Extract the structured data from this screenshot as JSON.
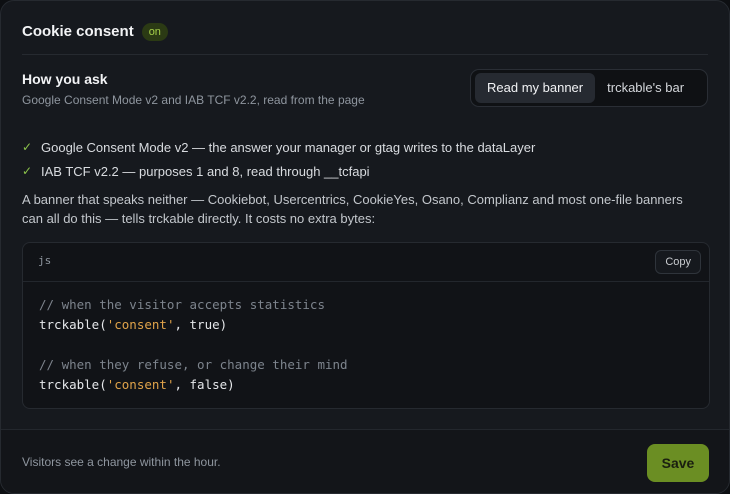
{
  "header": {
    "title": "Cookie consent",
    "badge": "on"
  },
  "section": {
    "title": "How you ask",
    "subtitle": "Google Consent Mode v2 and IAB TCF v2.2, read from the page"
  },
  "mode_toggle": {
    "options": [
      "Read my banner",
      "trckable's bar"
    ],
    "selected": "Read my banner"
  },
  "checks": [
    "Google Consent Mode v2 — the answer your manager or gtag writes to the dataLayer",
    "IAB TCF v2.2 — purposes 1 and 8, read through __tcfapi"
  ],
  "paragraph": "A banner that speaks neither — Cookiebot, Usercentrics, CookieYes, Osano, Complianz and most one-file banners can all do this — tells trckable directly. It costs no extra bytes:",
  "code": {
    "language": "js",
    "copy_label": "Copy",
    "comment_accept": "// when the visitor accepts statistics",
    "call_accept": {
      "fn": "trckable(",
      "arg": "'consent'",
      "rest": ", true)"
    },
    "comment_refuse": "// when they refuse, or change their mind",
    "call_refuse": {
      "fn": "trckable(",
      "arg": "'consent'",
      "rest": ", false)"
    }
  },
  "footer": {
    "note": "Visitors see a change within the hour.",
    "save_label": "Save"
  },
  "colors": {
    "accent": "#6b8e23",
    "check": "#8bc34a",
    "string": "#e0a34a"
  }
}
